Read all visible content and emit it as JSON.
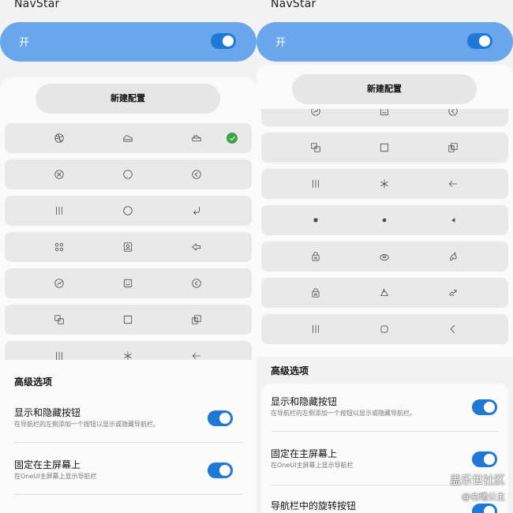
{
  "app_title": "NavStar",
  "master_toggle": {
    "label": "开",
    "on": true
  },
  "new_config_label": "新建配置",
  "advanced_title": "高级选项",
  "options": [
    {
      "title": "显示和隐藏按钮",
      "desc": "在导航栏的左侧添加一个按钮以显示或隐藏导航栏。",
      "on": true
    },
    {
      "title": "固定在主屏幕上",
      "desc": "在OneUI主屏幕上显示导航栏",
      "on": true
    },
    {
      "title": "导航栏中的旋转按钮",
      "desc": "",
      "on": true
    }
  ],
  "left_rows": [
    {
      "icons": [
        "dribbble-icon",
        "cake-slice-icon",
        "cake-icon"
      ],
      "selected": true
    },
    {
      "icons": [
        "circle-x-icon",
        "circle-icon",
        "circle-back-icon"
      ],
      "selected": false
    },
    {
      "icons": [
        "triple-bar-icon",
        "circle-icon",
        "return-arrow-icon"
      ],
      "selected": false
    },
    {
      "icons": [
        "four-dots-icon",
        "portrait-icon",
        "arrow-left-outline-icon"
      ],
      "selected": false
    },
    {
      "icons": [
        "gauge-icon",
        "smile-box-icon",
        "circle-back-icon"
      ],
      "selected": false
    },
    {
      "icons": [
        "windows-icon",
        "square-icon",
        "windows-arrow-icon"
      ],
      "selected": false
    },
    {
      "icons": [
        "triple-bar-icon",
        "asterisk-icon",
        "arrow-left-icon"
      ],
      "selected": false
    }
  ],
  "right_rows": [
    {
      "icons": [
        "gauge-icon",
        "smile-box-icon",
        "circle-back-icon"
      ]
    },
    {
      "icons": [
        "windows-icon",
        "square-icon",
        "windows-arrow-icon"
      ]
    },
    {
      "icons": [
        "triple-bar-icon",
        "asterisk-icon",
        "arrow-left-icon"
      ]
    },
    {
      "icons": [
        "square-filled-icon",
        "circle-filled-icon",
        "triangle-left-icon"
      ]
    },
    {
      "icons": [
        "cake-box-icon",
        "donut-icon",
        "unicorn-icon"
      ]
    },
    {
      "icons": [
        "cake-box-icon",
        "cake-plate-icon",
        "dragon-icon"
      ]
    },
    {
      "icons": [
        "triple-bar-icon",
        "rounded-square-icon",
        "chevron-left-icon"
      ]
    }
  ],
  "watermark": {
    "line1": "盖乐世社区",
    "line2": "@右曦公主"
  },
  "colors": {
    "accent": "#1f78d6",
    "master_bar": "#6aa6ec",
    "check": "#3aa54a"
  }
}
